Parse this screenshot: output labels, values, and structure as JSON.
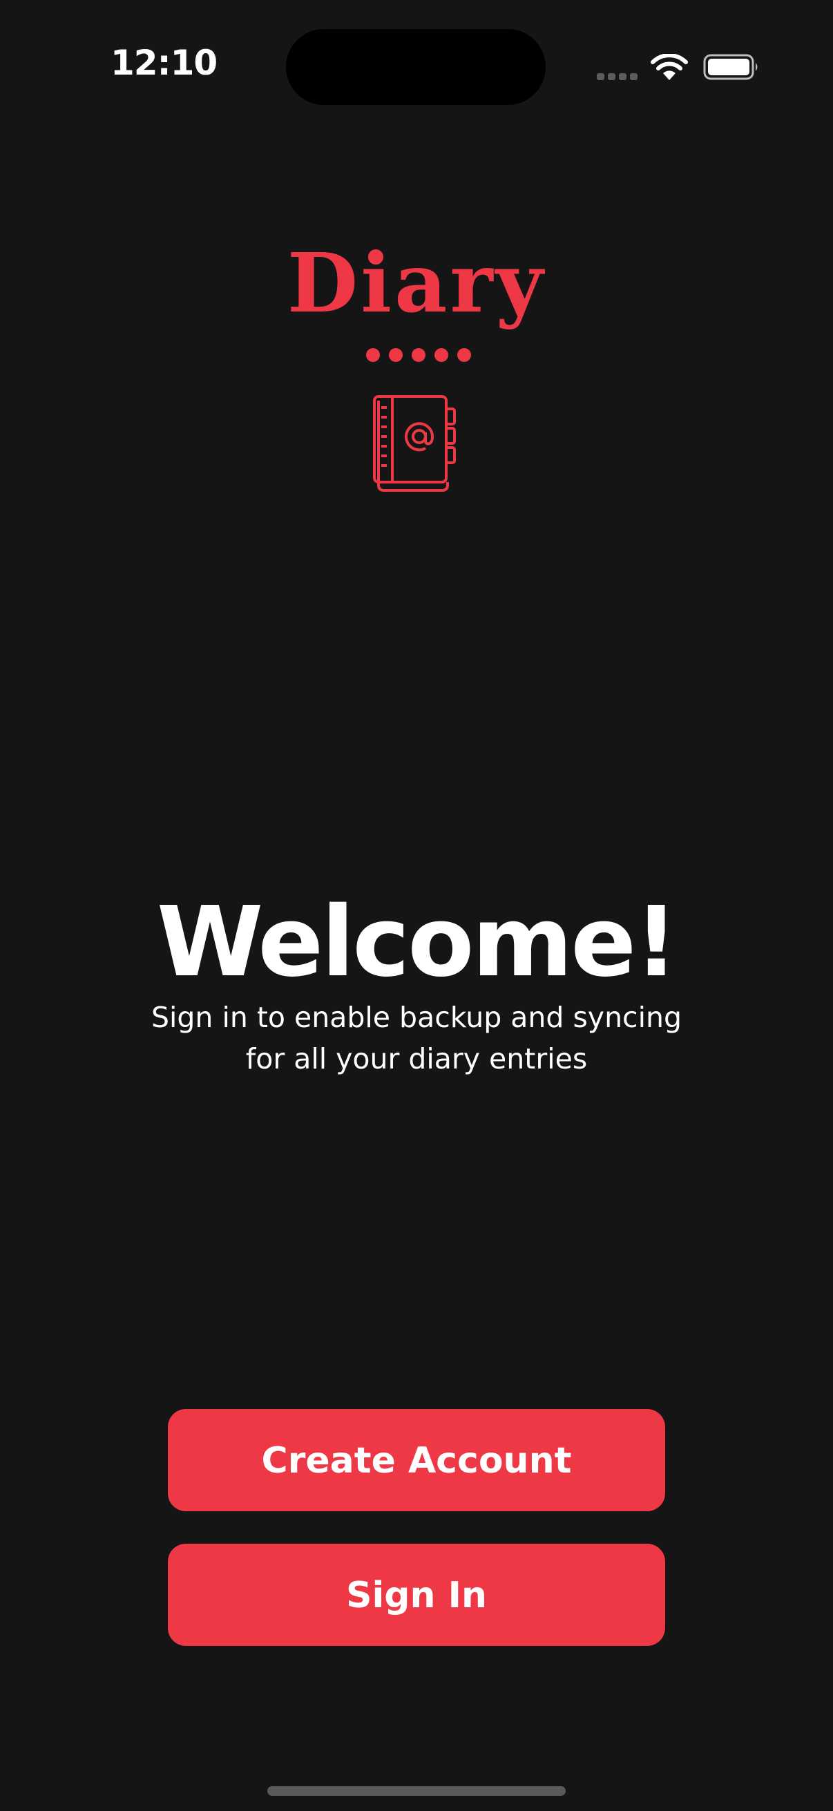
{
  "status_bar": {
    "time": "12:10",
    "icons": [
      "cellular-signal-icon",
      "wifi-icon",
      "battery-icon"
    ]
  },
  "brand": {
    "title": "Diary",
    "icon": "address-book-at-icon",
    "accent_color": "#EE3846"
  },
  "welcome": {
    "heading": "Welcome!",
    "subtitle_line1": "Sign in to enable backup and syncing",
    "subtitle_line2": "for all your diary entries"
  },
  "actions": {
    "create_account_label": "Create Account",
    "sign_in_label": "Sign In"
  },
  "colors": {
    "background": "#151515",
    "accent": "#EE3846",
    "text": "#FFFFFF"
  }
}
